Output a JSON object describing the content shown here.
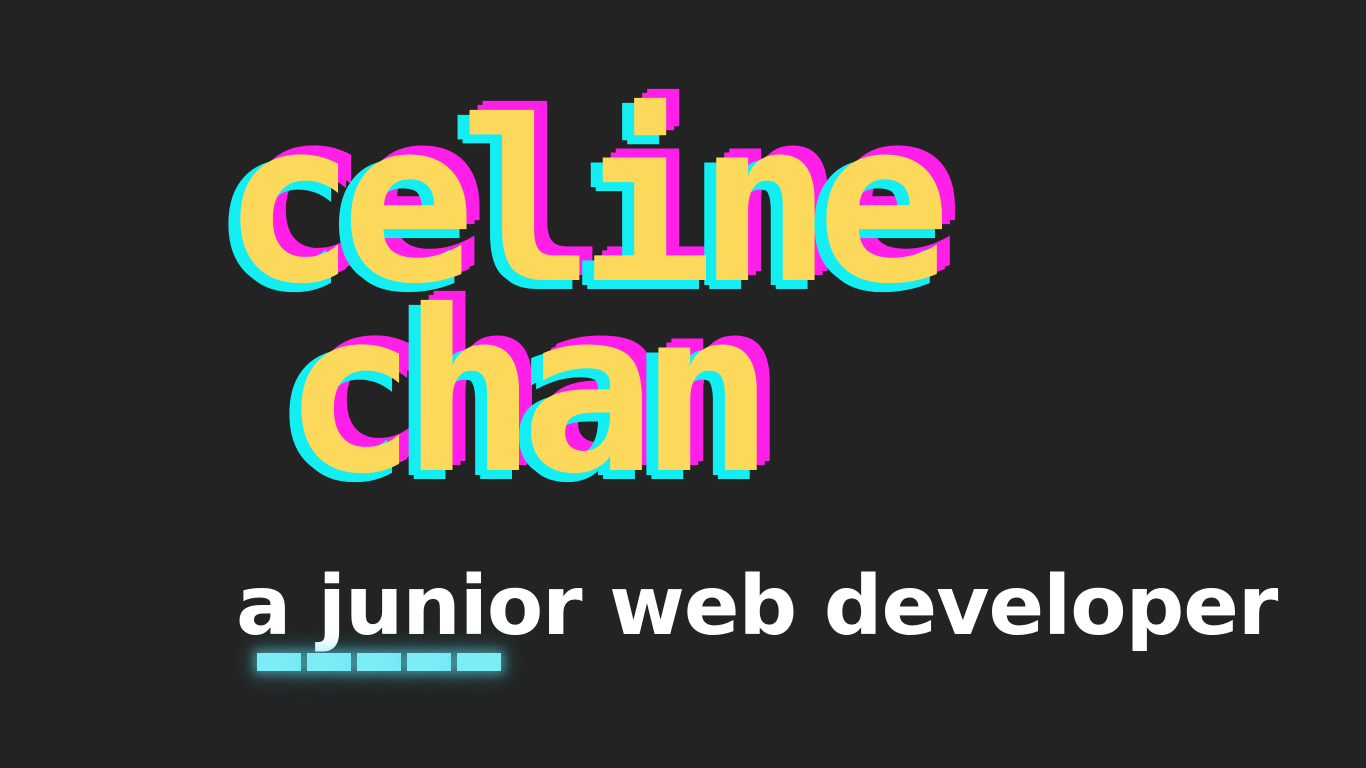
{
  "hero": {
    "first_name": "celine",
    "last_name": "chan",
    "tagline": "a junior web developer"
  },
  "cursor": {
    "dash_count": 5,
    "color": "#7cecf7"
  },
  "colors": {
    "background": "#232323",
    "name_fill": "#fdd95b",
    "name_shadow_cyan": "#13eef2",
    "name_shadow_magenta": "#ff1fe9",
    "tagline": "#ffffff"
  }
}
